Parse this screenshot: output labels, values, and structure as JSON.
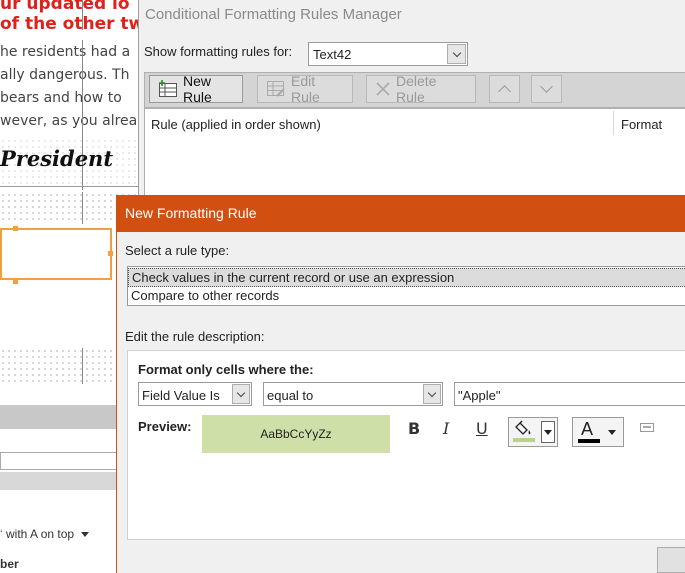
{
  "background_report": {
    "red_line1": "ur updated lo",
    "red_line2": "of the other tw",
    "text_line1": "he residents had a",
    "text_line2": "ally dangerous.  Th",
    "text_line3": "bears and how to",
    "text_line4": "wever, as you alrea",
    "president": "President",
    "sort_text": "with A on top",
    "bottom_text": "ber"
  },
  "manager": {
    "title": "Conditional Formatting Rules Manager",
    "show_rules_label": "Show formatting rules for:",
    "show_rules_value": "Text42",
    "toolbar": {
      "new_rule": "New Rule",
      "edit_rule": "Edit Rule",
      "delete_rule": "Delete Rule"
    },
    "list_headers": {
      "rule": "Rule (applied in order shown)",
      "format": "Format"
    }
  },
  "new_rule_dialog": {
    "title": "New Formatting Rule",
    "select_type_label": "Select a rule type:",
    "rule_types": [
      "Check values in the current record or use an expression",
      "Compare to other records"
    ],
    "selected_type_index": 0,
    "edit_label": "Edit the rule description:",
    "format_only_label": "Format only cells where the:",
    "field_combo": "Field Value Is",
    "operator_combo": "equal to",
    "value_input": "\"Apple\"",
    "preview_label": "Preview:",
    "preview_text": "AaBbCcYyZz",
    "bold": "B",
    "italic": "I",
    "underline": "U",
    "font_color_glyph": "A",
    "colors": {
      "preview_fill": "#cfdfa8",
      "fill_swatch": "#b9d28a",
      "font_color_swatch": "#000000",
      "title_bar": "#d24f12"
    }
  }
}
